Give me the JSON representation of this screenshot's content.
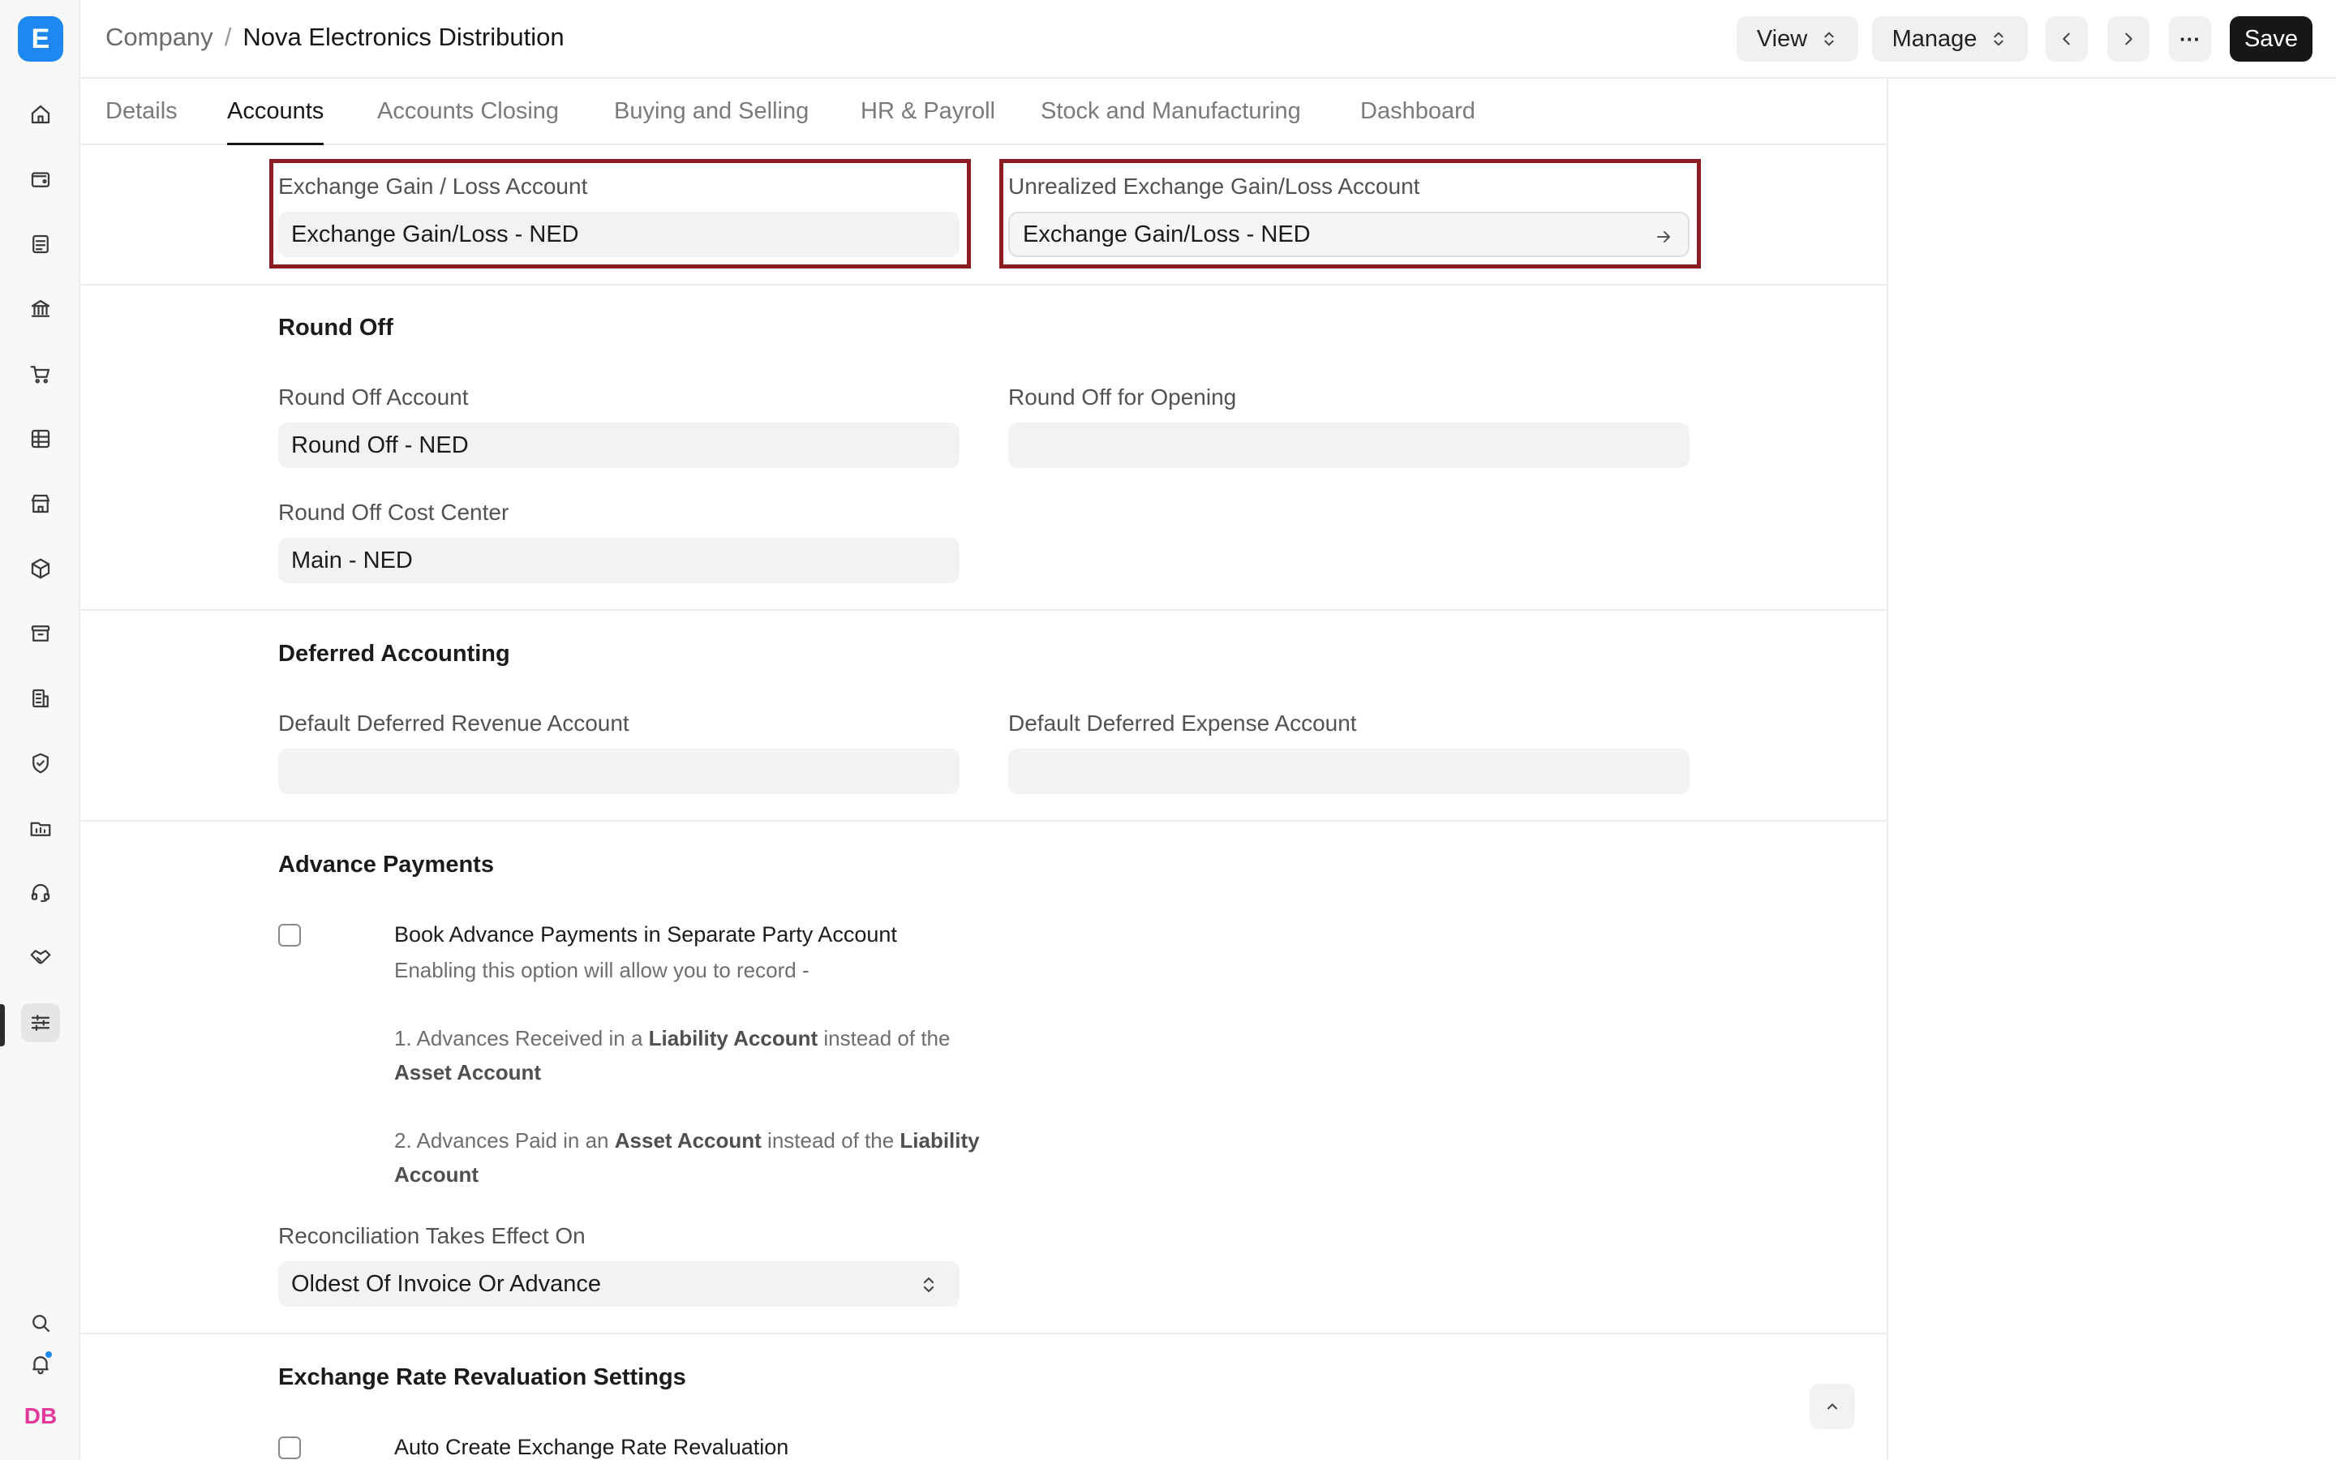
{
  "app": {
    "logo_letter": "E"
  },
  "sidebar": {
    "icons": [
      "home-icon",
      "wallet-icon",
      "invoice-icon",
      "bank-icon",
      "cart-icon",
      "table-icon",
      "store-icon",
      "box-icon",
      "archive-icon",
      "building-icon",
      "shield-icon",
      "folder-chart-icon",
      "headset-icon",
      "handshake-icon",
      "settings-sliders-icon"
    ],
    "avatar_initials": "DB"
  },
  "header": {
    "breadcrumb_parent": "Company",
    "breadcrumb_sep": "/",
    "breadcrumb_current": "Nova Electronics Distribution",
    "view_label": "View",
    "manage_label": "Manage",
    "more_label": "···",
    "save_label": "Save"
  },
  "tabs": [
    {
      "label": "Details"
    },
    {
      "label": "Accounts"
    },
    {
      "label": "Accounts Closing"
    },
    {
      "label": "Buying and Selling"
    },
    {
      "label": "HR & Payroll"
    },
    {
      "label": "Stock and Manufacturing"
    },
    {
      "label": "Dashboard"
    }
  ],
  "active_tab": "Accounts",
  "exchange": {
    "gain_loss_label": "Exchange Gain / Loss Account",
    "gain_loss_value": "Exchange Gain/Loss - NED",
    "unrealized_label": "Unrealized Exchange Gain/Loss Account",
    "unrealized_value": "Exchange Gain/Loss - NED"
  },
  "round_off": {
    "title": "Round Off",
    "account_label": "Round Off Account",
    "account_value": "Round Off - NED",
    "opening_label": "Round Off for Opening",
    "opening_value": "",
    "cost_center_label": "Round Off Cost Center",
    "cost_center_value": "Main - NED"
  },
  "deferred": {
    "title": "Deferred Accounting",
    "revenue_label": "Default Deferred Revenue Account",
    "revenue_value": "",
    "expense_label": "Default Deferred Expense Account",
    "expense_value": ""
  },
  "advance": {
    "title": "Advance Payments",
    "checkbox_label": "Book Advance Payments in Separate Party Account",
    "checked": false,
    "desc_intro": "Enabling this option will allow you to record -",
    "desc1_a": "1. Advances Received in a ",
    "desc1_b": "Liability Account",
    "desc1_c": " instead of the ",
    "desc1_d": "Asset Account",
    "desc2_a": "2. Advances Paid in an ",
    "desc2_b": "Asset Account",
    "desc2_c": " instead of the ",
    "desc2_d": "Liability Account",
    "reconciliation_label": "Reconciliation Takes Effect On",
    "reconciliation_value": "Oldest Of Invoice Or Advance"
  },
  "revaluation": {
    "title": "Exchange Rate Revaluation Settings",
    "checkbox_label": "Auto Create Exchange Rate Revaluation",
    "checked": false
  },
  "colors": {
    "highlight": "#8d1c22",
    "accent": "#1e88f0",
    "avatar": "#e0399b"
  }
}
